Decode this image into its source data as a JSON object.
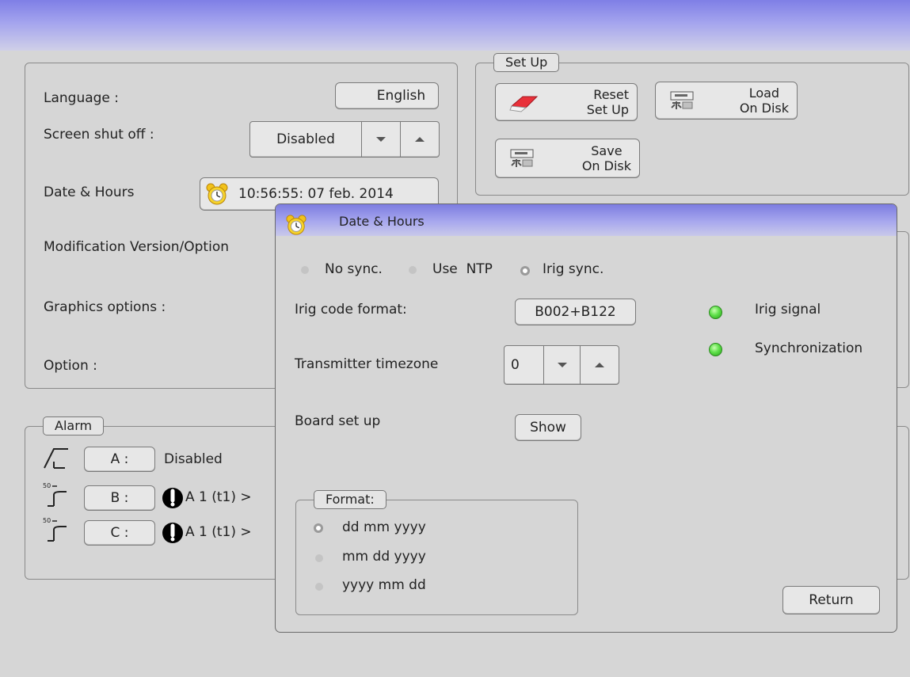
{
  "settings": {
    "language_label": "Language :",
    "language_value": "English",
    "screen_label": "Screen shut off :",
    "screen_value": "Disabled",
    "date_label": "Date & Hours",
    "date_value": "10:56:55: 07 feb. 2014",
    "modification_label": "Modification Version/Option",
    "graphics_label": "Graphics options :",
    "option_label": "Option :"
  },
  "setup": {
    "title": "Set Up",
    "reset_line1": "Reset",
    "reset_line2": "Set Up",
    "load_line1": "Load",
    "load_line2": "On Disk",
    "save_line1": "Save",
    "save_line2": "On Disk"
  },
  "alarm": {
    "title": "Alarm",
    "rows": [
      {
        "key": "A :",
        "text": "Disabled"
      },
      {
        "key": "B :",
        "text": "A 1 (t1) >"
      },
      {
        "key": "C :",
        "text": "A 1 (t1) >"
      }
    ]
  },
  "dialog": {
    "title": "Date & Hours",
    "sync_options": [
      "No sync.",
      "Use  NTP",
      "Irig sync."
    ],
    "sync_selected": "Irig sync.",
    "irig_format_label": "Irig code format:",
    "irig_format_value": "B002+B122",
    "timezone_label": "Transmitter timezone",
    "timezone_value": "0",
    "board_label": "Board set up",
    "show_label": "Show",
    "irig_signal_label": "Irig signal",
    "sync_status_label": "Synchronization",
    "status_color": "#4fd83a",
    "format_title": "Format:",
    "format_options": [
      "dd mm yyyy",
      "mm dd yyyy",
      "yyyy mm dd"
    ],
    "format_selected": "dd mm yyyy",
    "return_label": "Return"
  },
  "icons": [
    "alarm-clock-icon",
    "eraser-icon",
    "disk-drive-icon",
    "rising-edge-icon",
    "threshold-icon",
    "exclamation-icon",
    "down-arrow-icon",
    "up-arrow-icon"
  ]
}
